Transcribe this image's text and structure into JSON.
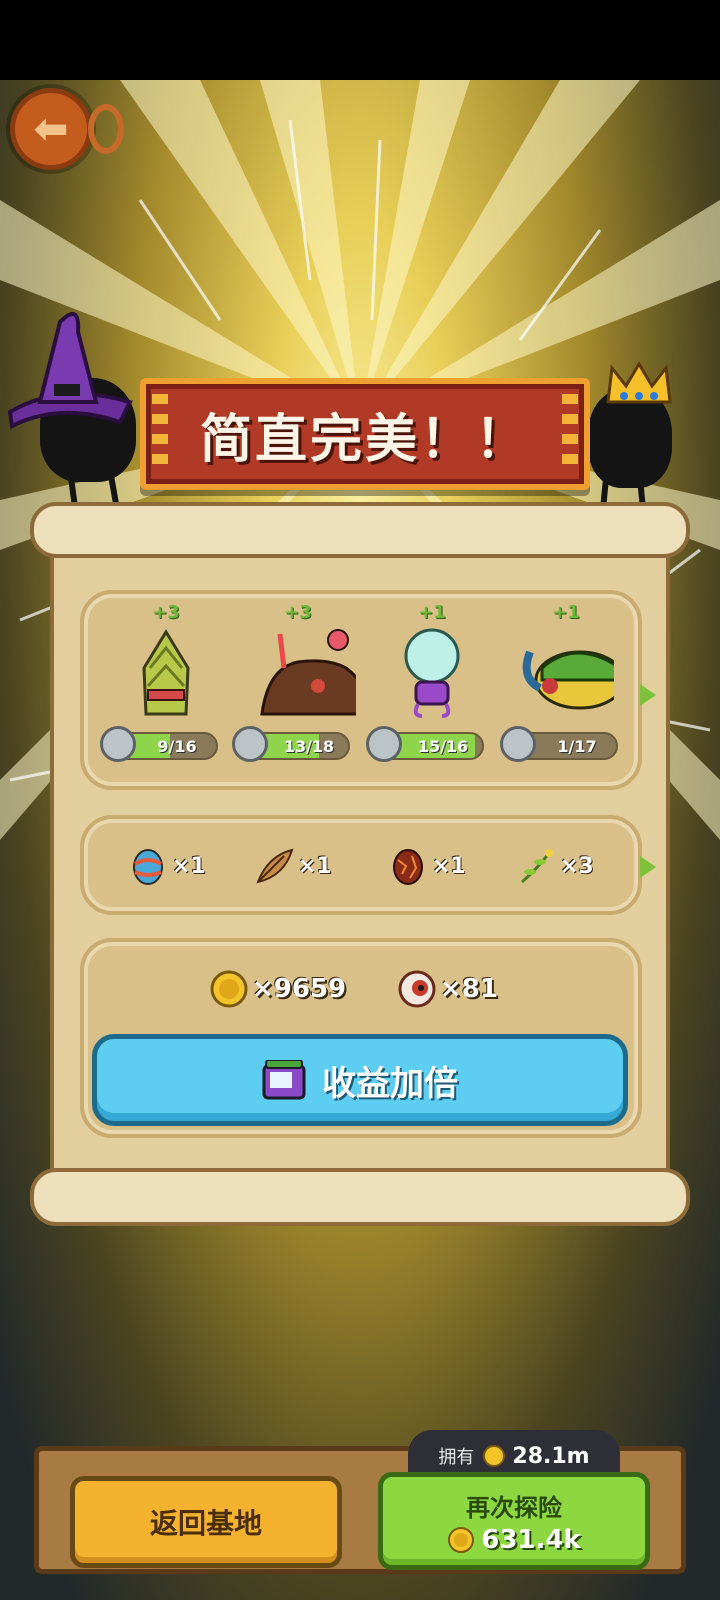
{
  "banner": {
    "title": "简直完美！！"
  },
  "monsters": [
    {
      "name": "bamboo-shoot-monster",
      "bonus": "+3",
      "progress": "9/16",
      "ratio": 0.5625
    },
    {
      "name": "chocolate-candy-monster",
      "bonus": "+3",
      "progress": "13/18",
      "ratio": 0.7222
    },
    {
      "name": "lightbulb-monster",
      "bonus": "+1",
      "progress": "15/16",
      "ratio": 0.9375
    },
    {
      "name": "beetle-monster",
      "bonus": "+1",
      "progress": "1/17",
      "ratio": 0.0588
    }
  ],
  "items": [
    {
      "icon": "painted-egg-icon",
      "qty": "×1"
    },
    {
      "icon": "feather-icon",
      "qty": "×1"
    },
    {
      "icon": "lava-egg-icon",
      "qty": "×1"
    },
    {
      "icon": "herb-sprig-icon",
      "qty": "×3"
    }
  ],
  "rewards": {
    "coins": "×9659",
    "eyeballs": "×81"
  },
  "double_button": {
    "label": "收益加倍"
  },
  "bottom": {
    "return_label": "返回基地",
    "owned_label": "拥有",
    "owned_value": "28.1m",
    "again_label": "再次探险",
    "again_cost": "631.4k"
  },
  "colors": {
    "banner": "#b03a26",
    "double_button": "#5ecdf2",
    "return_button": "#f5b22e",
    "again_button": "#8dd840",
    "progress_fill": "#8fd54c"
  }
}
